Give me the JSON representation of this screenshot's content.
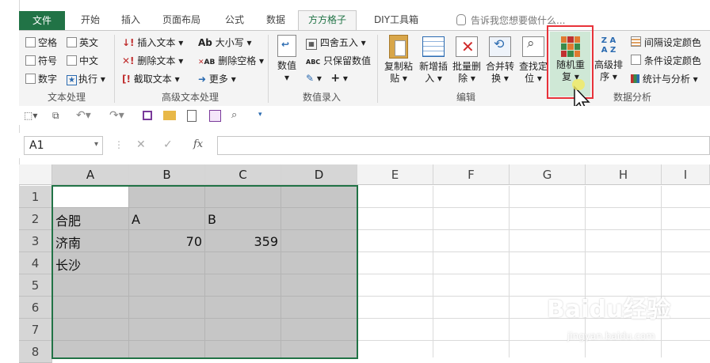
{
  "tabs": {
    "file": "文件",
    "items": [
      "开始",
      "插入",
      "页面布局",
      "公式",
      "数据",
      "方方格子",
      "DIY工具箱"
    ],
    "active": "方方格子",
    "tell_me": "告诉我您想要做什么..."
  },
  "ribbon": {
    "text_group": {
      "label": "文本处理",
      "checks": [
        "空格",
        "英文",
        "符号",
        "中文",
        "数字"
      ],
      "exec": "执行"
    },
    "adv_text_group": {
      "label": "高级文本处理",
      "insert_text": "插入文本",
      "delete_text": "删除文本",
      "extract_text": "截取文本",
      "case": "大小写",
      "delete_space": "删除空格",
      "more": "更多"
    },
    "value_group": {
      "label": "数值录入",
      "value_btn": "数值",
      "round": "四舍五入",
      "keep_value": "只保留数值"
    },
    "edit_group": {
      "label": "编辑",
      "copy_paste": [
        "复制粘",
        "贴"
      ],
      "insert": [
        "新增插",
        "入"
      ],
      "batch_delete": [
        "批量删",
        "除"
      ],
      "merge": [
        "合并转",
        "换"
      ],
      "find": [
        "查找定",
        "位"
      ]
    },
    "analysis_group": {
      "label": "数据分析",
      "random": [
        "随机重",
        "复"
      ],
      "sort": [
        "高级排",
        "序"
      ],
      "interval_color": "间隔设定颜色",
      "cond_color": "条件设定颜色",
      "stats": "统计与分析"
    }
  },
  "formula_bar": {
    "name_box": "A1",
    "fx": "fx",
    "value": ""
  },
  "sheet": {
    "columns": [
      "A",
      "B",
      "C",
      "D",
      "E",
      "F",
      "G",
      "H",
      "I"
    ],
    "rows": [
      "1",
      "2",
      "3",
      "4",
      "5",
      "6",
      "7",
      "8"
    ],
    "cells": {
      "A2": "合肥",
      "B2": "A",
      "C2": "B",
      "A3": "济南",
      "B3": "70",
      "C3": "359",
      "A4": "长沙"
    }
  },
  "watermark": {
    "brand": "Baidu经验",
    "url": "jingyan.baidu.com"
  }
}
